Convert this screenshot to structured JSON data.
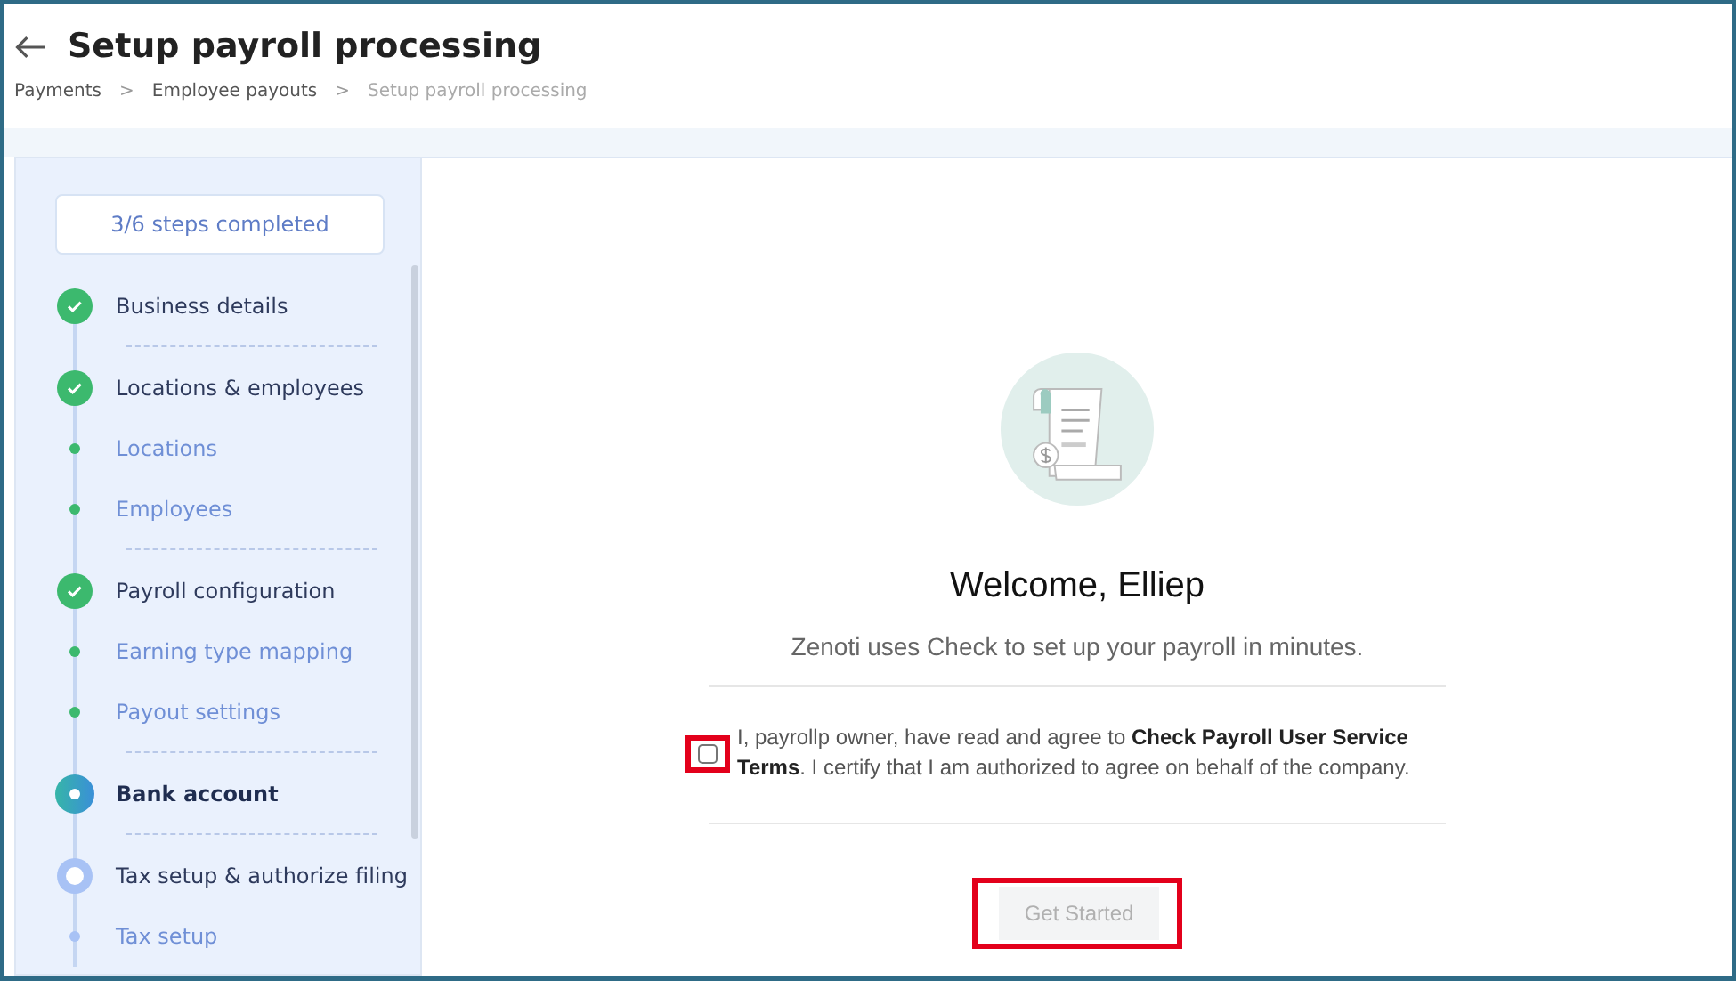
{
  "header": {
    "title": "Setup payroll processing",
    "separator": ">",
    "breadcrumbs": [
      {
        "label": "Payments",
        "current": false
      },
      {
        "label": "Employee payouts",
        "current": false
      },
      {
        "label": "Setup payroll processing",
        "current": true
      }
    ]
  },
  "sidebar": {
    "progress": "3/6 steps completed",
    "steps": [
      {
        "kind": "step",
        "label": "Business details",
        "completed": true,
        "active": false,
        "divider_after": true
      },
      {
        "kind": "step",
        "label": "Locations & employees",
        "completed": true,
        "active": false,
        "divider_after": false
      },
      {
        "kind": "substep",
        "label": "Locations",
        "completed": true,
        "active": false,
        "divider_after": false
      },
      {
        "kind": "substep",
        "label": "Employees",
        "completed": true,
        "active": false,
        "divider_after": true
      },
      {
        "kind": "step",
        "label": "Payroll configuration",
        "completed": true,
        "active": false,
        "divider_after": false
      },
      {
        "kind": "substep",
        "label": "Earning type mapping",
        "completed": true,
        "active": false,
        "divider_after": false
      },
      {
        "kind": "substep",
        "label": "Payout settings",
        "completed": true,
        "active": false,
        "divider_after": true
      },
      {
        "kind": "step",
        "label": "Bank account",
        "completed": false,
        "active": true,
        "divider_after": true
      },
      {
        "kind": "step",
        "label": "Tax setup & authorize filing",
        "completed": false,
        "active": false,
        "divider_after": false
      },
      {
        "kind": "substep",
        "label": "Tax setup",
        "completed": false,
        "active": false,
        "divider_after": false
      }
    ]
  },
  "main": {
    "welcome": "Welcome,",
    "name": "Elliep",
    "subtitle": "Zenoti uses Check to set up your payroll in minutes.",
    "terms": {
      "checked": false,
      "highlighted": true,
      "text": "I, payrollp owner, have read and agree to **Check Payroll User Service Terms**. I certify that I am authorized to agree on behalf of the company."
    },
    "button": {
      "label": "Get Started",
      "disabled": true,
      "highlighted": true
    }
  }
}
